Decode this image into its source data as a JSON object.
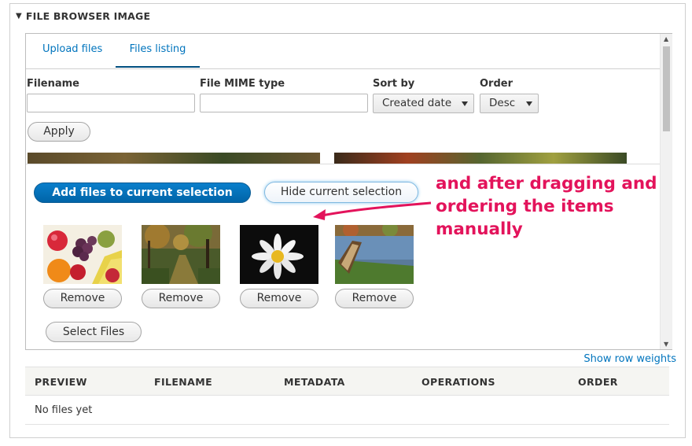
{
  "fieldset": {
    "legend": "FILE BROWSER IMAGE"
  },
  "tabs": [
    {
      "label": "Upload files",
      "active": false
    },
    {
      "label": "Files listing",
      "active": true
    }
  ],
  "filters": {
    "filename": {
      "label": "Filename",
      "value": ""
    },
    "mime": {
      "label": "File MIME type",
      "value": ""
    },
    "sort_by": {
      "label": "Sort by",
      "selected": "Created date"
    },
    "order": {
      "label": "Order",
      "selected": "Desc"
    },
    "apply_label": "Apply"
  },
  "selection": {
    "add_label": "Add files to current selection",
    "hide_label": "Hide current selection",
    "items": [
      {
        "icon": "fruit-photo",
        "remove_label": "Remove"
      },
      {
        "icon": "forest-path-photo",
        "remove_label": "Remove"
      },
      {
        "icon": "daisy-photo",
        "remove_label": "Remove"
      },
      {
        "icon": "boat-lake-photo",
        "remove_label": "Remove"
      }
    ],
    "select_files_label": "Select Files"
  },
  "annotation": {
    "text": "and after dragging and ordering the items manually",
    "color": "#e3135b"
  },
  "table": {
    "show_weights": "Show row weights",
    "columns": [
      "PREVIEW",
      "FILENAME",
      "METADATA",
      "OPERATIONS",
      "ORDER"
    ],
    "empty_text": "No files yet"
  },
  "colors": {
    "accent": "#0074bd",
    "primary_button": "#0071b8"
  }
}
